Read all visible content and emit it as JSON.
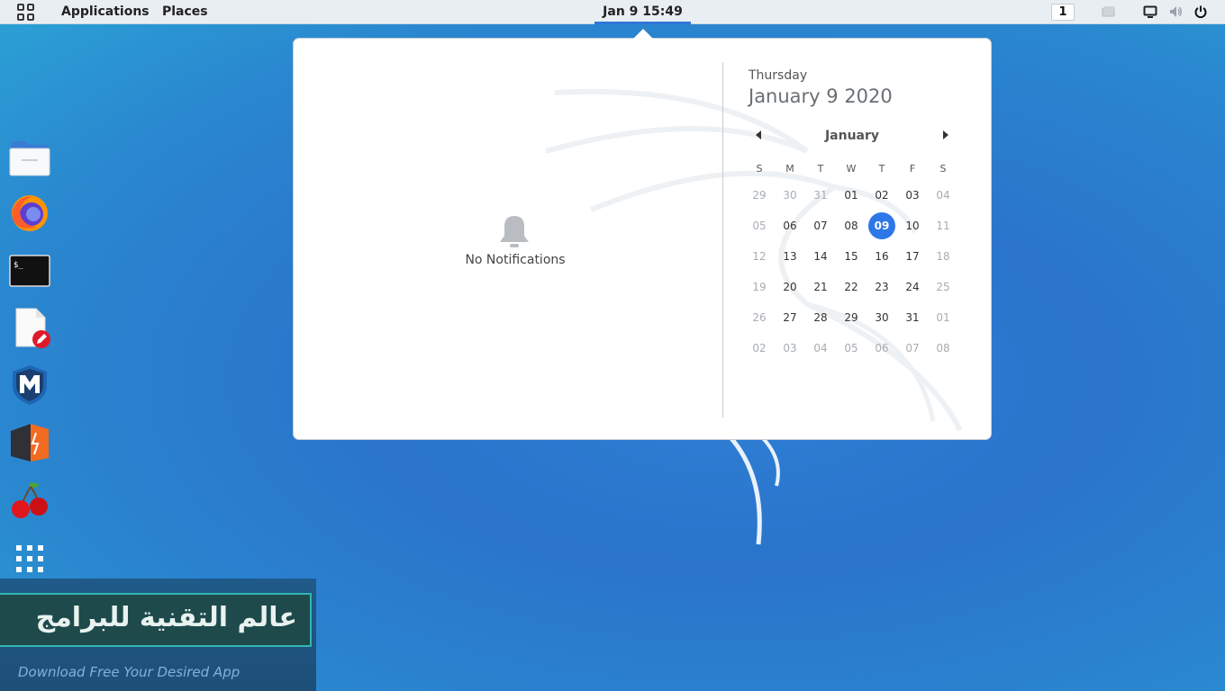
{
  "topbar": {
    "apps_grid_icon": "apps-grid-icon",
    "applications_label": "Applications",
    "places_label": "Places",
    "clock": "Jan 9  15:49",
    "workspace_number": "1",
    "icons": [
      "screen-icon",
      "display-icon",
      "volume-icon",
      "power-icon"
    ]
  },
  "popover": {
    "no_notifications": "No Notifications",
    "day_name": "Thursday",
    "full_date": "January 9 2020",
    "calendar": {
      "month": "January",
      "weekday_headers": [
        "S",
        "M",
        "T",
        "W",
        "T",
        "F",
        "S"
      ],
      "weeks": [
        [
          {
            "d": "29",
            "m": true
          },
          {
            "d": "30",
            "m": true
          },
          {
            "d": "31",
            "m": true
          },
          {
            "d": "01"
          },
          {
            "d": "02"
          },
          {
            "d": "03"
          },
          {
            "d": "04",
            "m": true
          }
        ],
        [
          {
            "d": "05",
            "m": true
          },
          {
            "d": "06"
          },
          {
            "d": "07"
          },
          {
            "d": "08"
          },
          {
            "d": "09",
            "today": true
          },
          {
            "d": "10"
          },
          {
            "d": "11",
            "m": true
          }
        ],
        [
          {
            "d": "12",
            "m": true
          },
          {
            "d": "13"
          },
          {
            "d": "14"
          },
          {
            "d": "15"
          },
          {
            "d": "16"
          },
          {
            "d": "17"
          },
          {
            "d": "18",
            "m": true
          }
        ],
        [
          {
            "d": "19",
            "m": true
          },
          {
            "d": "20"
          },
          {
            "d": "21"
          },
          {
            "d": "22"
          },
          {
            "d": "23"
          },
          {
            "d": "24"
          },
          {
            "d": "25",
            "m": true
          }
        ],
        [
          {
            "d": "26",
            "m": true
          },
          {
            "d": "27"
          },
          {
            "d": "28"
          },
          {
            "d": "29"
          },
          {
            "d": "30"
          },
          {
            "d": "31"
          },
          {
            "d": "01",
            "m": true
          }
        ],
        [
          {
            "d": "02",
            "m": true
          },
          {
            "d": "03",
            "m": true
          },
          {
            "d": "04",
            "m": true
          },
          {
            "d": "05",
            "m": true
          },
          {
            "d": "06",
            "m": true
          },
          {
            "d": "07",
            "m": true
          },
          {
            "d": "08",
            "m": true
          }
        ]
      ]
    }
  },
  "dock": {
    "items": [
      "files-icon",
      "firefox-icon",
      "terminal-icon",
      "text-editor-icon",
      "metasploit-icon",
      "burpsuite-icon",
      "cherrytree-icon",
      "show-apps-icon"
    ]
  },
  "banner": {
    "title": "عالم التقنية للبرامج",
    "subtitle": "Download Free Your Desired App"
  },
  "colors": {
    "accent": "#2e77e8",
    "desktop": "#2a74cb"
  }
}
